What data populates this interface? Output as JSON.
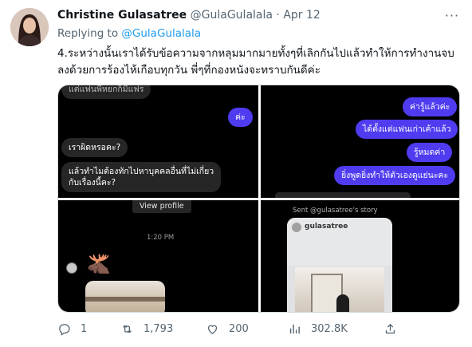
{
  "tweet": {
    "author_name": "Christine Gulasatree",
    "author_handle": "@GulaGulalala",
    "separator": "·",
    "date": "Apr 12",
    "more_label": "···",
    "reply_prefix": "Replying to",
    "reply_handle": "@GulaGulalala",
    "text": "4.ระหว่างนั้นเราได้รับข้อความจากหลุมมากมายทั้งๆที่เลิกกันไปแล้วทำให้การทำงานจบลงด้วยการร้องไห้เกือบทุกวัน พี่ๆที่กองหนังจะทราบกันดีค่ะ"
  },
  "media": {
    "panel1": {
      "top_cut": "แต่แฟนพี่หยกก็มีแฟร",
      "out_1": "ค่ะ",
      "in_1": "เราผิดหรอคะ?",
      "in_2_line1": "แล้วทำไมต้องทักไปหาบุคคลอื่นที่ไม่เกี่ยว",
      "in_2_line2": "กับเรื่องนี้คะ?"
    },
    "panel2": {
      "out_1": "ค่ารู้แล้วค่ะ",
      "out_2": "ได้ตั้งแต่แฟนเก่าเค้าแล้ว",
      "out_3": "รู้หมดค่า",
      "out_4": "ยิ่งพูดยิ่งทำให้ตัวเองดูแย่นะคะ"
    },
    "panel3": {
      "view_profile": "View profile",
      "time": "1:20 PM",
      "moose": "🫎"
    },
    "panel4": {
      "sent_label": "Sent @gulasatree's story",
      "story_user": "gulasatree"
    }
  },
  "actions": {
    "replies": "1",
    "retweets": "1,793",
    "likes": "200",
    "views": "302.8K"
  },
  "colors": {
    "link": "#1d9bf0",
    "secondary_text": "#536471",
    "outgoing_bubble": "#4f3cf0",
    "incoming_bubble": "#262626"
  }
}
